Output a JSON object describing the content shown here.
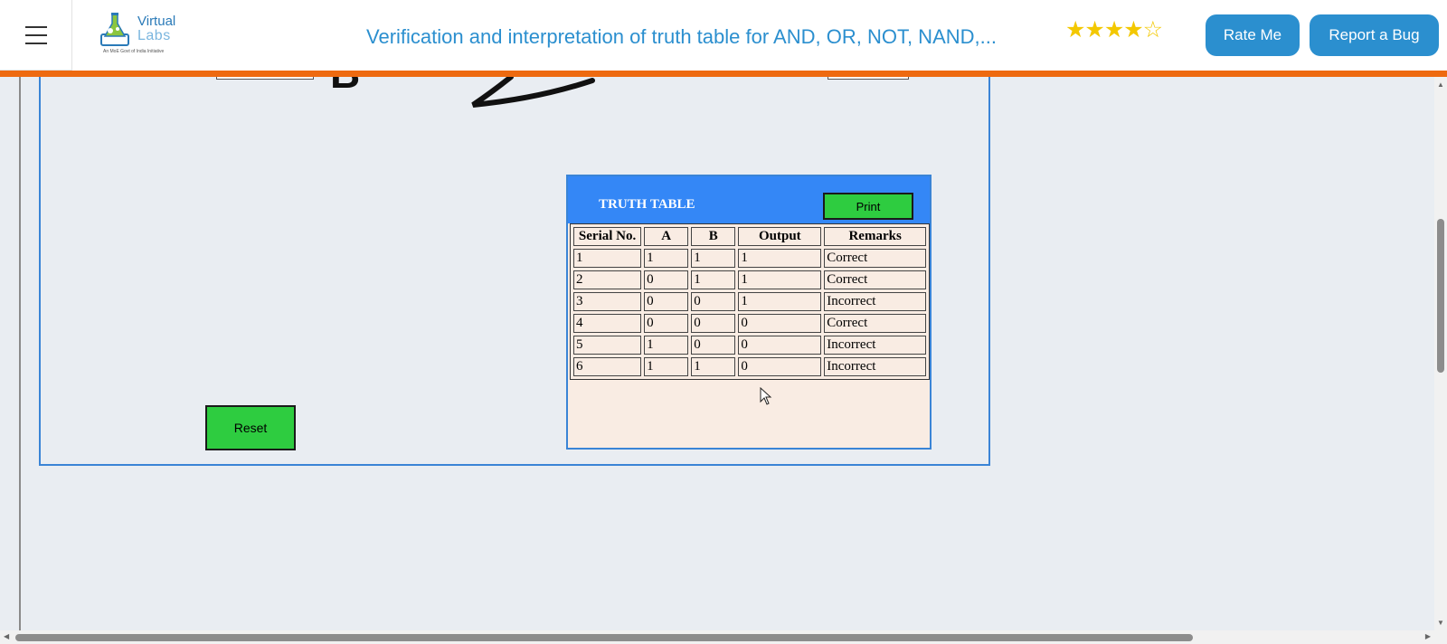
{
  "header": {
    "menu_icon": "hamburger-menu-icon",
    "logo": {
      "line1": "Virtual",
      "line2": "Labs",
      "tagline": "An MoE Govt of India Initiative"
    },
    "title": "Verification and interpretation of truth table for AND, OR, NOT, NAND,...",
    "rating": {
      "value": 4,
      "max": 5,
      "filled_stars": "★★★★",
      "empty_stars": "☆"
    },
    "rate_label": "Rate Me",
    "bug_label": "Report a Bug",
    "accent_color": "#ee6a10",
    "brand_color": "#2b8fcf"
  },
  "simulation": {
    "gate_partial_label": "B",
    "reset_label": "Reset"
  },
  "truth_table": {
    "title": "TRUTH TABLE",
    "print_label": "Print",
    "columns": [
      "Serial No.",
      "A",
      "B",
      "Output",
      "Remarks"
    ],
    "rows": [
      [
        "1",
        "1",
        "1",
        "1",
        "Correct"
      ],
      [
        "2",
        "0",
        "1",
        "1",
        "Correct"
      ],
      [
        "3",
        "0",
        "0",
        "1",
        "Incorrect"
      ],
      [
        "4",
        "0",
        "0",
        "0",
        "Correct"
      ],
      [
        "5",
        "1",
        "0",
        "0",
        "Incorrect"
      ],
      [
        "6",
        "1",
        "1",
        "0",
        "Incorrect"
      ]
    ]
  },
  "icons": {
    "cursor": "mouse-pointer-icon",
    "scroll_up": "scroll-up-arrow-icon",
    "scroll_down": "scroll-down-arrow-icon",
    "scroll_left": "scroll-left-arrow-icon",
    "scroll_right": "scroll-right-arrow-icon"
  }
}
